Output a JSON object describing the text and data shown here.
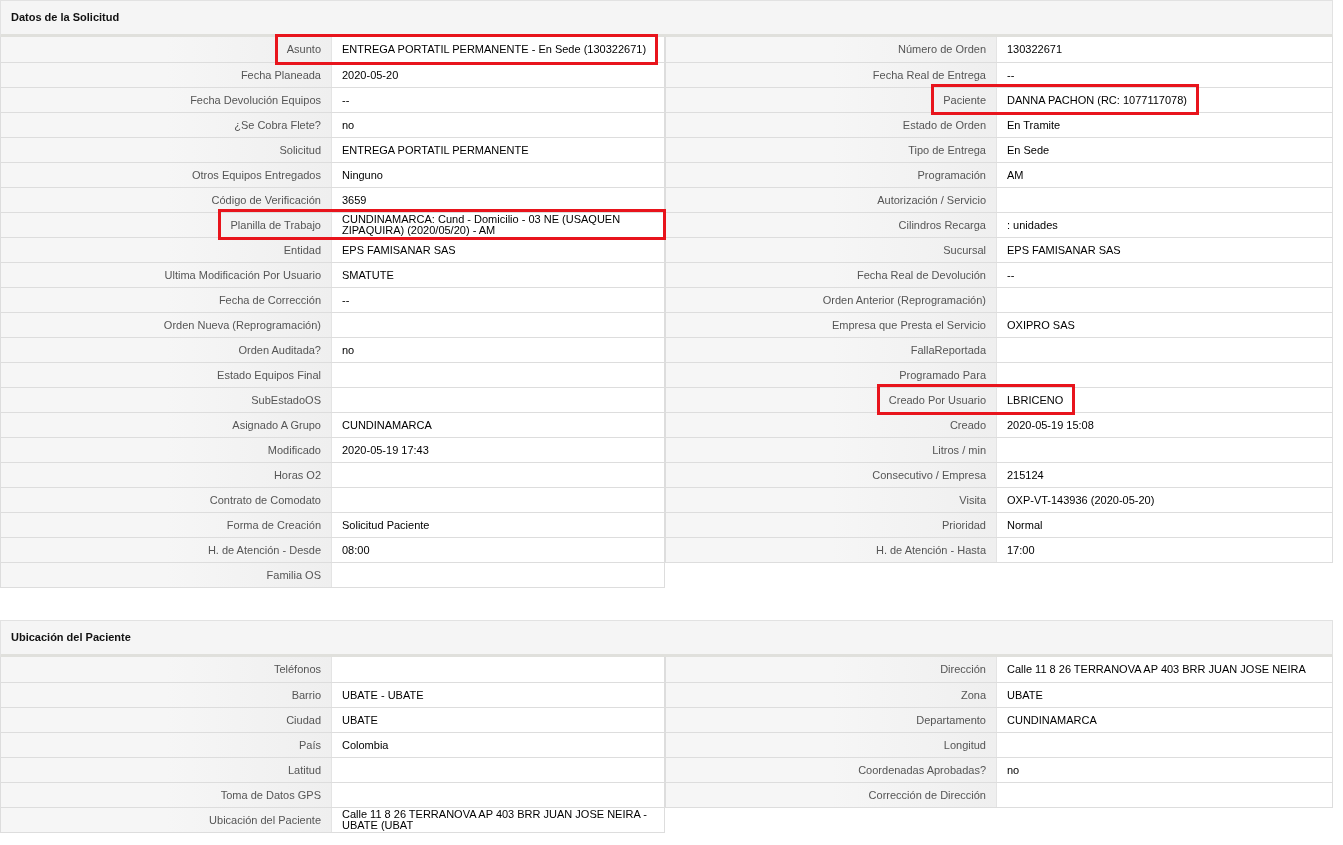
{
  "sections": [
    {
      "title": "Datos de la Solicitud",
      "left": [
        {
          "label": "Asunto",
          "value": "ENTREGA PORTATIL PERMANENTE - En Sede (130322671)",
          "highlighted": true
        },
        {
          "label": "Fecha Planeada",
          "value": "2020-05-20",
          "highlighted": false
        },
        {
          "label": "Fecha Devolución Equipos",
          "value": "--",
          "highlighted": false
        },
        {
          "label": "¿Se Cobra Flete?",
          "value": "no",
          "highlighted": false
        },
        {
          "label": "Solicitud",
          "value": "ENTREGA PORTATIL PERMANENTE",
          "highlighted": false
        },
        {
          "label": "Otros Equipos Entregados",
          "value": "Ninguno",
          "highlighted": false
        },
        {
          "label": "Código de Verificación",
          "value": "3659",
          "highlighted": false
        },
        {
          "label": "Planilla de Trabajo",
          "value": "CUNDINAMARCA: Cund - Domicilio - 03 NE (USAQUEN ZIPAQUIRA) (2020/05/20) - AM",
          "highlighted": true
        },
        {
          "label": "Entidad",
          "value": "EPS FAMISANAR SAS",
          "highlighted": false
        },
        {
          "label": "Ultima Modificación Por Usuario",
          "value": "SMATUTE",
          "highlighted": false
        },
        {
          "label": "Fecha de Corrección",
          "value": "--",
          "highlighted": false
        },
        {
          "label": "Orden Nueva (Reprogramación)",
          "highlighted": false
        },
        {
          "label": "Orden Auditada?",
          "value": "no",
          "highlighted": false
        },
        {
          "label": "Estado Equipos Final",
          "highlighted": false
        },
        {
          "label": "SubEstadoOS",
          "highlighted": false
        },
        {
          "label": "Asignado A Grupo",
          "value": "CUNDINAMARCA",
          "highlighted": false
        },
        {
          "label": "Modificado",
          "value": "2020-05-19 17:43",
          "highlighted": false
        },
        {
          "label": "Horas O2",
          "highlighted": false
        },
        {
          "label": "Contrato de Comodato",
          "highlighted": false
        },
        {
          "label": "Forma de Creación",
          "value": "Solicitud Paciente",
          "highlighted": false
        },
        {
          "label": "H. de Atención - Desde",
          "value": "08:00",
          "highlighted": false
        },
        {
          "label": "Familia OS",
          "highlighted": false
        }
      ],
      "right": [
        {
          "label": "Número de Orden",
          "value": "130322671",
          "highlighted": false
        },
        {
          "label": "Fecha Real de Entrega",
          "value": "--",
          "highlighted": false
        },
        {
          "label": "Paciente",
          "value": "DANNA PACHON (RC: 1077117078)",
          "highlighted": true
        },
        {
          "label": "Estado de Orden",
          "value": "En Tramite",
          "highlighted": false
        },
        {
          "label": "Tipo de Entrega",
          "value": "En Sede",
          "highlighted": false
        },
        {
          "label": "Programación",
          "value": "AM",
          "highlighted": false
        },
        {
          "label": "Autorización / Servicio",
          "highlighted": false
        },
        {
          "label": "Cilindros Recarga",
          "value": ": unidades",
          "highlighted": false
        },
        {
          "label": "Sucursal",
          "value": "EPS FAMISANAR SAS",
          "highlighted": false
        },
        {
          "label": "Fecha Real de Devolución",
          "value": "--",
          "highlighted": false
        },
        {
          "label": "Orden Anterior (Reprogramación)",
          "highlighted": false
        },
        {
          "label": "Empresa que Presta el Servicio",
          "value": "OXIPRO SAS",
          "highlighted": false
        },
        {
          "label": "FallaReportada",
          "highlighted": false
        },
        {
          "label": "Programado Para",
          "highlighted": false
        },
        {
          "label": "Creado Por Usuario",
          "value": "LBRICENO",
          "highlighted": true
        },
        {
          "label": "Creado",
          "value": "2020-05-19 15:08",
          "highlighted": false
        },
        {
          "label": "Litros / min",
          "highlighted": false
        },
        {
          "label": "Consecutivo / Empresa",
          "value": "215124",
          "highlighted": false
        },
        {
          "label": "Visita",
          "value": "OXP-VT-143936 (2020-05-20)",
          "highlighted": false
        },
        {
          "label": "Prioridad",
          "value": "Normal",
          "highlighted": false
        },
        {
          "label": "H. de Atención - Hasta",
          "value": "17:00",
          "highlighted": false
        }
      ]
    },
    {
      "title": "Ubicación del Paciente",
      "left": [
        {
          "label": "Teléfonos",
          "highlighted": false
        },
        {
          "label": "Barrio",
          "value": "UBATE - UBATE",
          "highlighted": false
        },
        {
          "label": "Ciudad",
          "value": "UBATE",
          "highlighted": false
        },
        {
          "label": "País",
          "value": "Colombia",
          "highlighted": false
        },
        {
          "label": "Latitud",
          "highlighted": false
        },
        {
          "label": "Toma de Datos GPS",
          "highlighted": false
        },
        {
          "label": "Ubicación del Paciente",
          "value": "Calle 11 8 26 TERRANOVA AP 403 BRR JUAN JOSE NEIRA - UBATE (UBAT",
          "highlighted": false
        }
      ],
      "right": [
        {
          "label": "Dirección",
          "value": "Calle 11 8 26 TERRANOVA AP 403 BRR JUAN JOSE NEIRA",
          "highlighted": false
        },
        {
          "label": "Zona",
          "value": "UBATE",
          "highlighted": false
        },
        {
          "label": "Departamento",
          "value": "CUNDINAMARCA",
          "highlighted": false
        },
        {
          "label": "Longitud",
          "highlighted": false
        },
        {
          "label": "Coordenadas Aprobadas?",
          "value": "no",
          "highlighted": false
        },
        {
          "label": "Corrección de Dirección",
          "highlighted": false
        }
      ]
    }
  ]
}
